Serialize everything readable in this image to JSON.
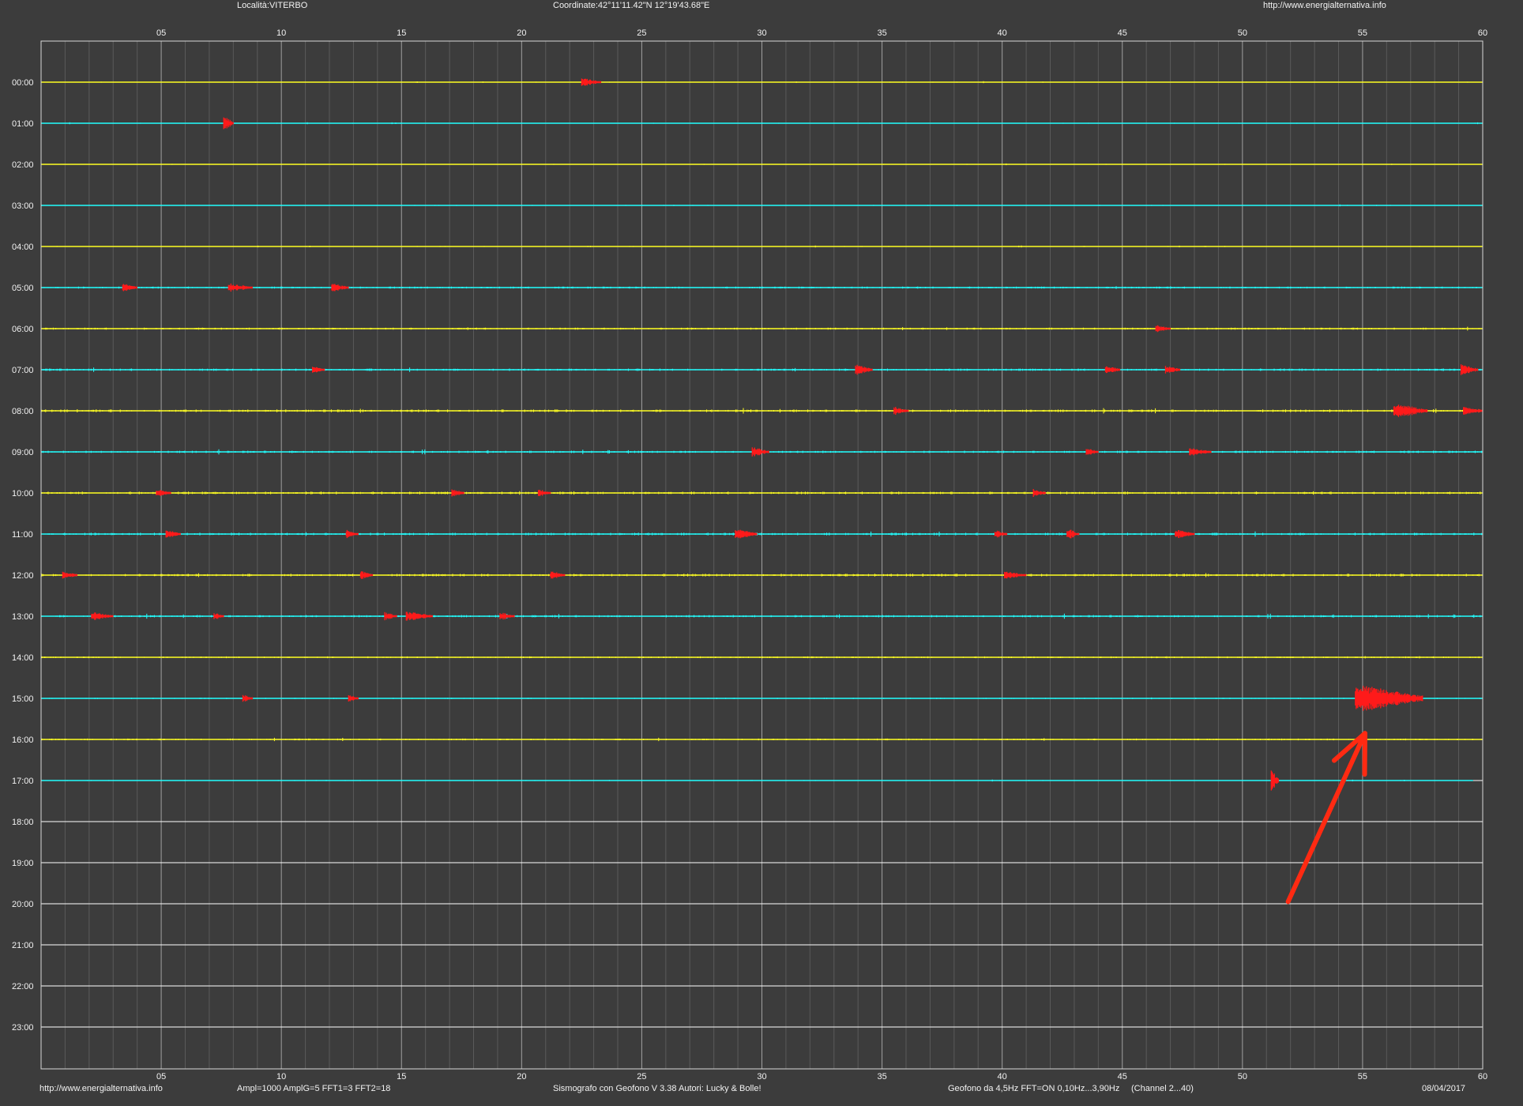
{
  "header": {
    "location": "Località:VITERBO",
    "coordinates": "Coordinate:42°11'11.42\"N  12°19'43.68\"E",
    "url": "http://www.energialternativa.info"
  },
  "footer": {
    "url": "http://www.energialternativa.info",
    "params": "Ampl=1000 AmplG=5 FFT1=3 FFT2=18",
    "software": "Sismografo con Geofono V 3.38  Autori: Lucky & Bolle!",
    "sensor": "Geofono da 4,5Hz FFT=ON 0,10Hz...3,90Hz",
    "channel": "(Channel 2...40)",
    "date": "08/04/2017"
  },
  "colors": {
    "background": "#3c3c3c",
    "even_hour_trace": "#ffff22",
    "odd_hour_trace": "#22ffff",
    "event_marker": "#ff1a1a",
    "annotation_arrow": "#ff2a12",
    "empty_hour_line": "#ffffff",
    "grid_major": "#a0a0a0",
    "grid_minor": "#5a5a5a"
  },
  "chart_data": {
    "type": "helicorder",
    "x_tick_labels": [
      "05",
      "10",
      "15",
      "20",
      "25",
      "30",
      "35",
      "40",
      "45",
      "50",
      "55",
      "60"
    ],
    "x_range_minutes": [
      0,
      60
    ],
    "hour_labels": [
      "00:00",
      "01:00",
      "02:00",
      "03:00",
      "04:00",
      "05:00",
      "06:00",
      "07:00",
      "08:00",
      "09:00",
      "10:00",
      "11:00",
      "12:00",
      "13:00",
      "14:00",
      "15:00",
      "16:00",
      "17:00",
      "18:00",
      "19:00",
      "20:00",
      "21:00",
      "22:00",
      "23:00"
    ],
    "recorded_until": {
      "hour": 17,
      "minute": 59.6
    },
    "noise_level_by_hour": [
      0.15,
      0.15,
      0.15,
      0.15,
      0.15,
      0.35,
      0.35,
      0.4,
      0.45,
      0.4,
      0.45,
      0.45,
      0.45,
      0.4,
      0.3,
      0.2,
      0.3,
      0.15
    ],
    "events": [
      {
        "hour": 0,
        "start_min": 22.5,
        "end_min": 23.3,
        "amplitude": 0.4
      },
      {
        "hour": 1,
        "start_min": 7.6,
        "end_min": 8.0,
        "amplitude": 1.0
      },
      {
        "hour": 5,
        "start_min": 3.4,
        "end_min": 4.0,
        "amplitude": 0.4
      },
      {
        "hour": 5,
        "start_min": 7.8,
        "end_min": 8.8,
        "amplitude": 0.4
      },
      {
        "hour": 5,
        "start_min": 12.1,
        "end_min": 12.8,
        "amplitude": 0.4
      },
      {
        "hour": 6,
        "start_min": 46.4,
        "end_min": 47.0,
        "amplitude": 0.3
      },
      {
        "hour": 7,
        "start_min": 11.3,
        "end_min": 11.8,
        "amplitude": 0.3
      },
      {
        "hour": 7,
        "start_min": 33.9,
        "end_min": 34.6,
        "amplitude": 0.6
      },
      {
        "hour": 7,
        "start_min": 44.3,
        "end_min": 44.9,
        "amplitude": 0.4
      },
      {
        "hour": 7,
        "start_min": 46.8,
        "end_min": 47.4,
        "amplitude": 0.4
      },
      {
        "hour": 7,
        "start_min": 59.1,
        "end_min": 59.8,
        "amplitude": 0.7
      },
      {
        "hour": 8,
        "start_min": 35.5,
        "end_min": 36.1,
        "amplitude": 0.4
      },
      {
        "hour": 8,
        "start_min": 56.3,
        "end_min": 57.7,
        "amplitude": 1.0
      },
      {
        "hour": 8,
        "start_min": 59.2,
        "end_min": 60.0,
        "amplitude": 0.5
      },
      {
        "hour": 9,
        "start_min": 29.6,
        "end_min": 30.3,
        "amplitude": 0.6
      },
      {
        "hour": 9,
        "start_min": 43.5,
        "end_min": 44.0,
        "amplitude": 0.4
      },
      {
        "hour": 9,
        "start_min": 47.8,
        "end_min": 48.7,
        "amplitude": 0.4
      },
      {
        "hour": 10,
        "start_min": 4.8,
        "end_min": 5.4,
        "amplitude": 0.4
      },
      {
        "hour": 10,
        "start_min": 17.1,
        "end_min": 17.6,
        "amplitude": 0.4
      },
      {
        "hour": 10,
        "start_min": 20.7,
        "end_min": 21.2,
        "amplitude": 0.3
      },
      {
        "hour": 10,
        "start_min": 41.3,
        "end_min": 41.8,
        "amplitude": 0.4
      },
      {
        "hour": 11,
        "start_min": 5.2,
        "end_min": 5.8,
        "amplitude": 0.4
      },
      {
        "hour": 11,
        "start_min": 12.7,
        "end_min": 13.2,
        "amplitude": 0.4
      },
      {
        "hour": 11,
        "start_min": 28.9,
        "end_min": 29.8,
        "amplitude": 0.6
      },
      {
        "hour": 11,
        "start_min": 39.7,
        "end_min": 40.2,
        "amplitude": 0.4
      },
      {
        "hour": 11,
        "start_min": 42.7,
        "end_min": 43.2,
        "amplitude": 0.7
      },
      {
        "hour": 11,
        "start_min": 47.2,
        "end_min": 48.0,
        "amplitude": 0.5
      },
      {
        "hour": 12,
        "start_min": 0.9,
        "end_min": 1.5,
        "amplitude": 0.4
      },
      {
        "hour": 12,
        "start_min": 13.3,
        "end_min": 13.8,
        "amplitude": 0.4
      },
      {
        "hour": 12,
        "start_min": 21.2,
        "end_min": 21.8,
        "amplitude": 0.4
      },
      {
        "hour": 12,
        "start_min": 40.1,
        "end_min": 41.0,
        "amplitude": 0.3
      },
      {
        "hour": 13,
        "start_min": 2.1,
        "end_min": 3.0,
        "amplitude": 0.4
      },
      {
        "hour": 13,
        "start_min": 7.2,
        "end_min": 7.6,
        "amplitude": 0.3
      },
      {
        "hour": 13,
        "start_min": 14.3,
        "end_min": 14.8,
        "amplitude": 0.4
      },
      {
        "hour": 13,
        "start_min": 15.2,
        "end_min": 16.3,
        "amplitude": 0.5
      },
      {
        "hour": 13,
        "start_min": 19.1,
        "end_min": 19.7,
        "amplitude": 0.4
      },
      {
        "hour": 15,
        "start_min": 8.4,
        "end_min": 8.8,
        "amplitude": 0.3
      },
      {
        "hour": 15,
        "start_min": 12.8,
        "end_min": 13.2,
        "amplitude": 0.3
      },
      {
        "hour": 15,
        "start_min": 54.7,
        "end_min": 57.5,
        "amplitude": 2.2
      },
      {
        "hour": 17,
        "start_min": 51.2,
        "end_min": 51.5,
        "amplitude": 1.6
      }
    ],
    "annotation_arrow": {
      "from": {
        "hour": 19.95,
        "minute": 51.9
      },
      "to": {
        "hour": 15.85,
        "minute": 55.1
      }
    }
  }
}
